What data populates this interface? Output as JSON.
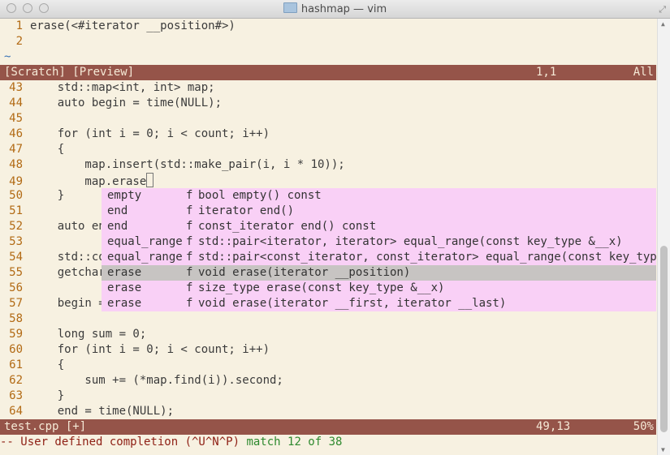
{
  "window": {
    "title": "hashmap — vim"
  },
  "scratch": {
    "lines": [
      {
        "num": "1",
        "text": "erase(<#iterator __position#>)"
      },
      {
        "num": "2",
        "text": ""
      }
    ],
    "tilde": "~",
    "status": {
      "name": "[Scratch] [Preview]",
      "pos": "1,1",
      "percent": "All"
    }
  },
  "code": {
    "lines": [
      {
        "num": "43",
        "text": "    std::map<int, int> map;"
      },
      {
        "num": "44",
        "text": "    auto begin = time(NULL);"
      },
      {
        "num": "45",
        "text": ""
      },
      {
        "num": "46",
        "text": "    for (int i = 0; i < count; i++)"
      },
      {
        "num": "47",
        "text": "    {"
      },
      {
        "num": "48",
        "text": "        map.insert(std::make_pair(i, i * 10));"
      },
      {
        "num": "49",
        "text": "        map.erase"
      },
      {
        "num": "50",
        "text": "    }"
      },
      {
        "num": "51",
        "text": ""
      },
      {
        "num": "52",
        "text": "    auto en"
      },
      {
        "num": "53",
        "text": ""
      },
      {
        "num": "54",
        "text": "    std::co"
      },
      {
        "num": "55",
        "text": "    getchar"
      },
      {
        "num": "56",
        "text": ""
      },
      {
        "num": "57",
        "text": "    begin ="
      },
      {
        "num": "58",
        "text": ""
      },
      {
        "num": "59",
        "text": "    long sum = 0;"
      },
      {
        "num": "60",
        "text": "    for (int i = 0; i < count; i++)"
      },
      {
        "num": "61",
        "text": "    {"
      },
      {
        "num": "62",
        "text": "        sum += (*map.find(i)).second;"
      },
      {
        "num": "63",
        "text": "    }"
      },
      {
        "num": "64",
        "text": "    end = time(NULL);"
      }
    ],
    "status": {
      "name": "test.cpp [+]",
      "pos": "49,13",
      "percent": "50%"
    }
  },
  "completion": {
    "selected_index": 5,
    "items": [
      {
        "word": "empty",
        "kind": "f",
        "info": "bool empty() const"
      },
      {
        "word": "end",
        "kind": "f",
        "info": "iterator end()"
      },
      {
        "word": "end",
        "kind": "f",
        "info": "const_iterator end() const"
      },
      {
        "word": "equal_range",
        "kind": "f",
        "info": "std::pair<iterator, iterator> equal_range(const key_type &__x)"
      },
      {
        "word": "equal_range",
        "kind": "f",
        "info": "std::pair<const_iterator, const_iterator> equal_range(const key_type &"
      },
      {
        "word": "erase",
        "kind": "f",
        "info": "void erase(iterator __position)"
      },
      {
        "word": "erase",
        "kind": "f",
        "info": "size_type erase(const key_type &__x)"
      },
      {
        "word": "erase",
        "kind": "f",
        "info": "void erase(iterator __first, iterator __last)"
      }
    ]
  },
  "message": {
    "mode": "-- User defined completion (^U^N^P)",
    "match": "match 12 of 38"
  },
  "colors": {
    "background": "#f7f1e1",
    "status_bar": "#955449",
    "status_text": "#f5e9d6",
    "line_number": "#b26a14",
    "popup": "#f9d0f6",
    "popup_selected": "#c7c4c2",
    "message_mode": "#8e1f14",
    "message_match": "#2f8a2f",
    "tilde": "#3a73b6"
  }
}
